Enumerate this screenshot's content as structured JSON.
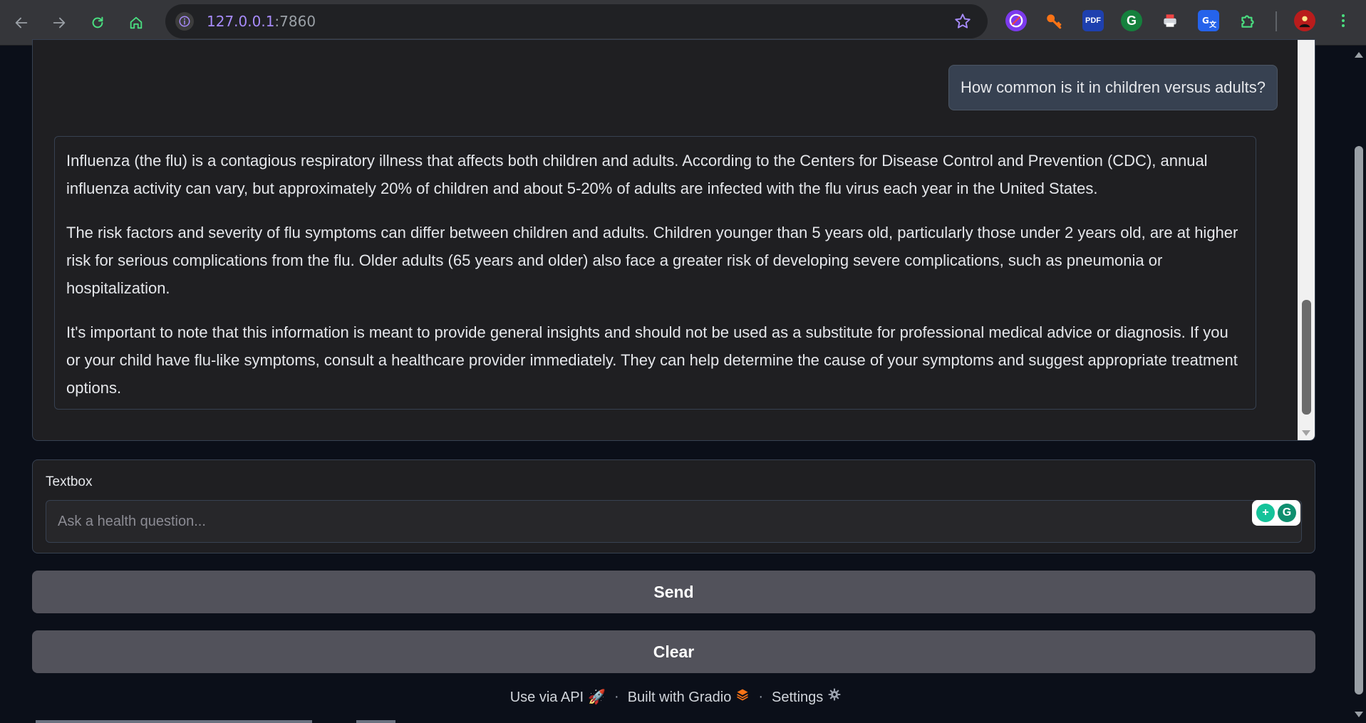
{
  "browser": {
    "url_host": "127.0.0.1",
    "url_port": ":7860",
    "ext_pdf_label": "PDF"
  },
  "chat": {
    "user_message": "How common is it in children versus adults?",
    "bot_paragraphs": [
      "Influenza (the flu) is a contagious respiratory illness that affects both children and adults. According to the Centers for Disease Control and Prevention (CDC), annual influenza activity can vary, but approximately 20% of children and about 5-20% of adults are infected with the flu virus each year in the United States.",
      "The risk factors and severity of flu symptoms can differ between children and adults. Children younger than 5 years old, particularly those under 2 years old, are at higher risk for serious complications from the flu. Older adults (65 years and older) also face a greater risk of developing severe complications, such as pneumonia or hospitalization.",
      "It's important to note that this information is meant to provide general insights and should not be used as a substitute for professional medical advice or diagnosis. If you or your child have flu-like symptoms, consult a healthcare provider immediately. They can help determine the cause of your symptoms and suggest appropriate treatment options."
    ]
  },
  "textbox": {
    "label": "Textbox",
    "value": "",
    "placeholder": "Ask a health question..."
  },
  "buttons": {
    "send": "Send",
    "clear": "Clear"
  },
  "footer": {
    "api": "Use via API",
    "built": "Built with Gradio",
    "settings": "Settings",
    "separator": "·"
  }
}
